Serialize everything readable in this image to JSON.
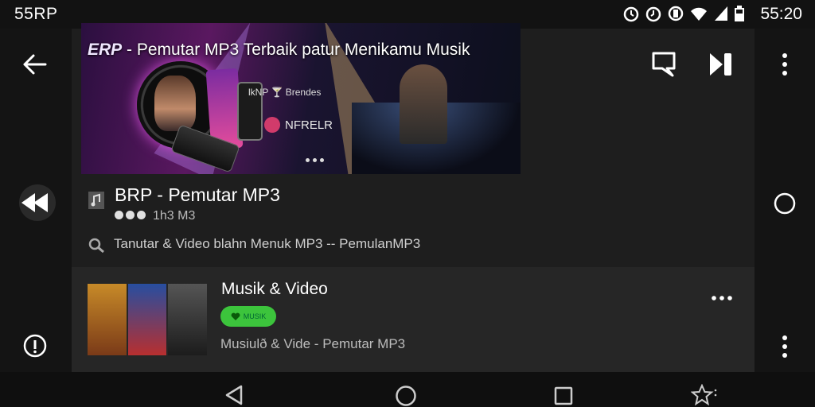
{
  "status_bar": {
    "carrier": "55RP",
    "time": "55:20",
    "icons": [
      "alarm-icon",
      "alarm-icon",
      "vibrate-icon",
      "wifi-icon",
      "signal-icon",
      "battery-icon"
    ]
  },
  "banner": {
    "brand": "ERP",
    "title": "- Pemutar MP3 Terbaik patur Menikamu Musik",
    "mini_text": "lkNP 🍸 Brendes",
    "logo_text": "NFRELR"
  },
  "app": {
    "title": "BRP - Pemutar MP3",
    "meta": "1h3  M3",
    "description": "Tanutar & Video blahn Menuk MP3 -- PemulanMP3"
  },
  "card": {
    "title": "Musik & Video",
    "badge": "MUSIK",
    "subtitle": "Musiulð & Vide - Pemutar MP3"
  },
  "colors": {
    "badge_green": "#3cc43c",
    "background": "#1d1d1d"
  }
}
